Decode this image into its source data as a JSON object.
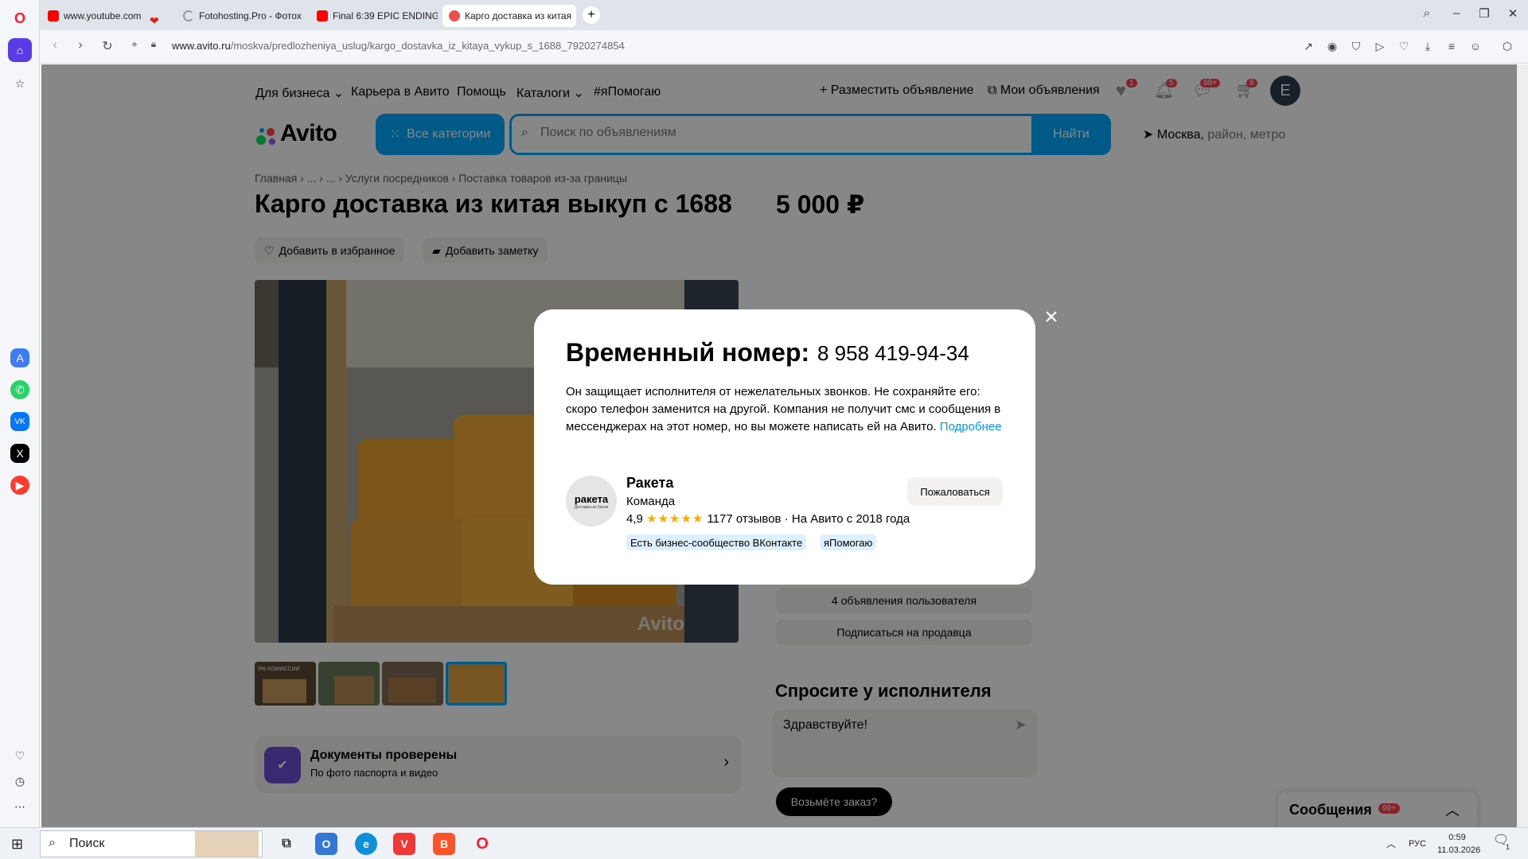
{
  "browser": {
    "tabs": [
      {
        "title": "www.youtube.com",
        "icon": "youtube-favicon"
      },
      {
        "title": "Fotohosting.Pro - Фотох",
        "icon": "loading-favicon"
      },
      {
        "title": "Final 6:39 EPIC ENDING N",
        "icon": "youtube-favicon"
      },
      {
        "title": "Карго доставка из китая",
        "icon": "recording-favicon",
        "active": true
      }
    ],
    "url_domain": "www.avito.ru",
    "url_path": "/moskva/predlozheniya_uslug/kargo_dostavka_iz_kitaya_vykup_s_1688_7920274854"
  },
  "avito": {
    "topnav": {
      "business": "Для бизнеса",
      "career": "Карьера в Авито",
      "help": "Помощь",
      "catalogs": "Каталоги",
      "ihelp": "#яПомогаю",
      "post_ad": "Разместить объявление",
      "my_ads": "Мои объявления",
      "badges": {
        "favorites": "1",
        "notifications": "5",
        "messages": "99+",
        "cart": "8"
      },
      "avatar_letter": "E"
    },
    "logo": "Avito",
    "all_categories": "Все категории",
    "search_placeholder": "Поиск по объявлениям",
    "search_button": "Найти",
    "location_city": "Москва,",
    "location_rest": " район, метро",
    "breadcrumbs": [
      "Главная",
      "...",
      "...",
      "Услуги посредников",
      "Поставка товаров из-за границы"
    ],
    "listing_title": "Карго доставка из китая выкуп с 1688",
    "price": "5 000 ₽",
    "add_favorite": "Добавить в избранное",
    "add_note": "Добавить заметку",
    "photo_watermark": "Avito",
    "thumb_caption": "0% КОМИССИИ",
    "docs_title": "Документы проверены",
    "docs_subtitle": "По фото паспорта и видео",
    "user_ads": "4 объявления пользователя",
    "subscribe": "Подписаться на продавца",
    "ask_title": "Спросите у исполнителя",
    "ask_message": "Здравствуйте!",
    "take_order": "Возьмёте заказ?",
    "messages_label": "Сообщения",
    "messages_badge": "99+"
  },
  "modal": {
    "title": "Временный номер:",
    "phone": "8 958 419-94-34",
    "description": "Он защищает исполнителя от нежелательных звонков. Не сохраняйте его: скоро телефон заменится на другой. Компания не получит смс и сообщения в мессенджерах на этот номер, но вы можете написать ей на Авито.",
    "more_link": "Подробнее",
    "seller_logo_text": "ракета",
    "seller_logo_sub": "Доставка из Китая",
    "seller_name": "Ракета",
    "seller_status": "Команда",
    "rating": "4,9",
    "stars": "★★★★★",
    "reviews": "1177 отзывов",
    "since": "· На Авито с 2018 года",
    "badges": [
      "Есть бизнес-сообщество ВКонтакте",
      "яПомогаю"
    ],
    "complain": "Пожаловаться"
  },
  "taskbar": {
    "search": "Поиск",
    "language": "РУС",
    "time": "0:59",
    "date": "11.03.2026",
    "notif_count": "1"
  },
  "colors": {
    "avito_blue": "#00aaff",
    "link_blue": "#0099f7",
    "badge_red": "#ff4053",
    "opera_red": "#ff1b2d"
  }
}
